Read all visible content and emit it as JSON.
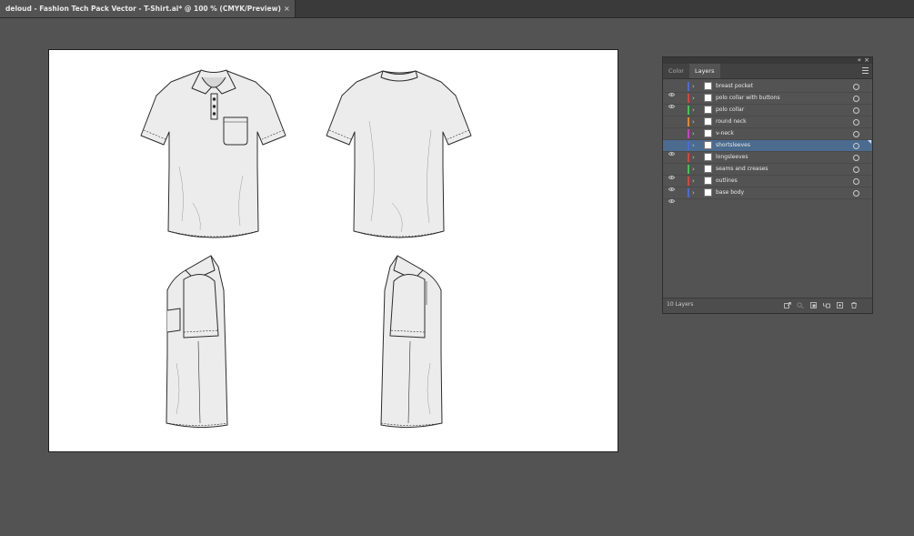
{
  "document_tab": {
    "title": "deloud - Fashion Tech Pack Vector - T-Shirt.ai* @ 100 % (CMYK/Preview)",
    "close_glyph": "×"
  },
  "artboard": {
    "background": "#ffffff",
    "drawings": [
      "polo-front-view",
      "polo-back-view",
      "polo-left-side-view",
      "polo-right-side-view"
    ]
  },
  "panel": {
    "tabs": [
      {
        "label": "Color",
        "active": false
      },
      {
        "label": "Layers",
        "active": true
      }
    ],
    "collapse_glyph": "«",
    "close_glyph": "×",
    "layers": [
      {
        "name": "breast pocket",
        "visible": true,
        "color": "#4b6bd6",
        "selected": false
      },
      {
        "name": "polo collar with buttons",
        "visible": true,
        "color": "#e0413d",
        "selected": false
      },
      {
        "name": "polo collar",
        "visible": false,
        "color": "#3cc94f",
        "selected": false
      },
      {
        "name": "round neck",
        "visible": false,
        "color": "#e8862a",
        "selected": false
      },
      {
        "name": "v-neck",
        "visible": false,
        "color": "#d13ccb",
        "selected": false
      },
      {
        "name": "shortsleeves",
        "visible": true,
        "color": "#4b6bd6",
        "selected": true
      },
      {
        "name": "longsleeves",
        "visible": false,
        "color": "#e0413d",
        "selected": false
      },
      {
        "name": "seams and creases",
        "visible": true,
        "color": "#3cc94f",
        "selected": false
      },
      {
        "name": "outlines",
        "visible": true,
        "color": "#e0413d",
        "selected": false
      },
      {
        "name": "base body",
        "visible": true,
        "color": "#4b6bd6",
        "selected": false
      }
    ],
    "layer_count": "10 Layers",
    "bottom_buttons": [
      "export-icon",
      "locate-object-icon",
      "clipping-mask-icon",
      "new-sublayer-icon",
      "new-layer-icon",
      "delete-layer-icon"
    ]
  },
  "colors": {
    "workspace": "#535353",
    "selection": "#4b6b8f",
    "shirt_fill": "#ececec",
    "shirt_stroke": "#2b2b2b"
  }
}
